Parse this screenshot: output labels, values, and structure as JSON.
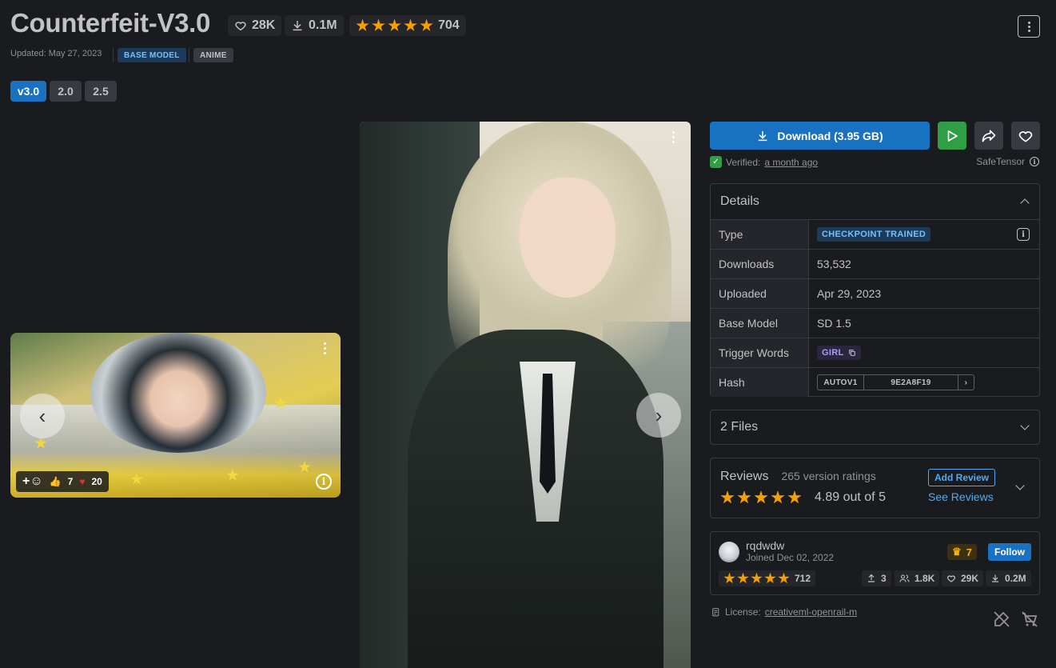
{
  "header": {
    "title": "Counterfeit-V3.0",
    "likes": "28K",
    "downloads": "0.1M",
    "rating_count": "704",
    "updated": "Updated: May 27, 2023",
    "badges": [
      "BASE MODEL",
      "ANIME"
    ]
  },
  "versions": [
    "v3.0",
    "2.0",
    "2.5"
  ],
  "gallery": {
    "thumb_reactions": {
      "thumbs": "7",
      "hearts": "20"
    }
  },
  "actions": {
    "download_label": "Download (3.95 GB)",
    "verified_label": "Verified:",
    "verified_time": "a month ago",
    "safetensor": "SafeTensor"
  },
  "details": {
    "heading": "Details",
    "rows": [
      {
        "key": "Type",
        "value": "CHECKPOINT TRAINED"
      },
      {
        "key": "Downloads",
        "value": "53,532"
      },
      {
        "key": "Uploaded",
        "value": "Apr 29, 2023"
      },
      {
        "key": "Base Model",
        "value": "SD 1.5"
      },
      {
        "key": "Trigger Words",
        "value": "GIRL"
      },
      {
        "key": "Hash",
        "value": "9E2A8F19",
        "hash_type": "AUTOV1"
      }
    ]
  },
  "files": {
    "heading": "2 Files"
  },
  "reviews": {
    "heading": "Reviews",
    "count_text": "265 version ratings",
    "score_text": "4.89 out of 5",
    "add_label": "Add Review",
    "see_label": "See Reviews"
  },
  "creator": {
    "name": "rqdwdw",
    "joined": "Joined Dec 02, 2022",
    "crown_count": "7",
    "follow_label": "Follow",
    "rating_count": "712",
    "uploads": "3",
    "followers": "1.8K",
    "likes": "29K",
    "downloads": "0.2M"
  },
  "license": {
    "label": "License:",
    "name": "creativeml-openrail-m"
  },
  "colors": {
    "accent": "#1971c2",
    "star": "#f59f00",
    "play": "#2f9e44",
    "background": "#1a1b1e"
  }
}
